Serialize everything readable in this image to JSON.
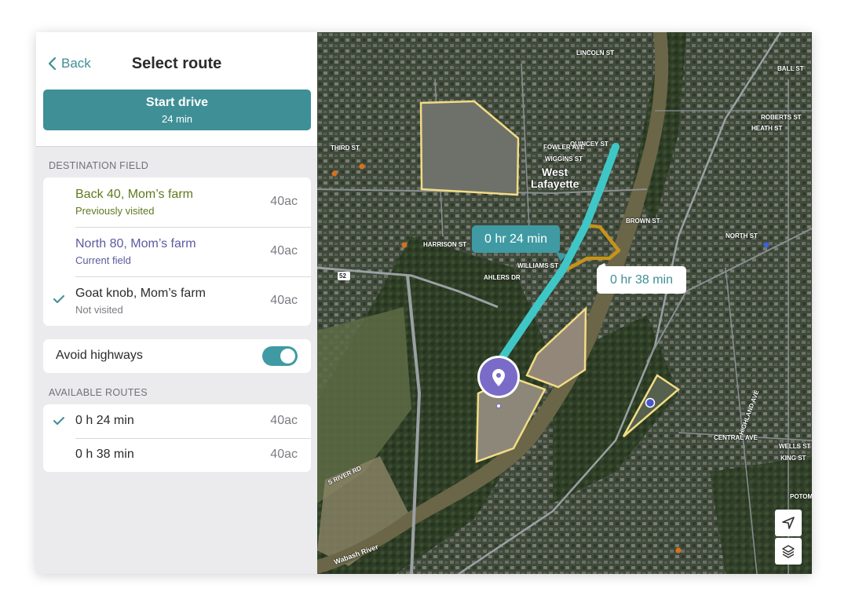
{
  "header": {
    "back_label": "Back",
    "title": "Select route"
  },
  "start_drive": {
    "label": "Start drive",
    "duration": "24 min"
  },
  "destination": {
    "section_label": "DESTINATION FIELD",
    "items": [
      {
        "name": "Back 40, Mom’s farm",
        "status": "Previously visited",
        "size": "40ac",
        "color": "#5e7a1f",
        "selected": false
      },
      {
        "name": "North 80, Mom’s farm",
        "status": "Current field",
        "size": "40ac",
        "color": "#5b5aa0",
        "selected": false
      },
      {
        "name": "Goat knob, Mom’s farm",
        "status": "Not visited",
        "size": "40ac",
        "color": "#2b2b2e",
        "selected": true
      }
    ]
  },
  "avoid_highways": {
    "label": "Avoid highways",
    "enabled": true
  },
  "routes": {
    "section_label": "AVAILABLE ROUTES",
    "items": [
      {
        "name": "0 h 24 min",
        "size": "40ac",
        "selected": true
      },
      {
        "name": "0 h 38 min",
        "size": "40ac",
        "selected": false
      }
    ]
  },
  "map": {
    "callout_primary": "0 hr 24 min",
    "callout_secondary": "0 hr 38 min",
    "city_label_1": "West",
    "city_label_2": "Lafayette",
    "street_labels": [
      "LINCOLN ST",
      "QUINCEY ST",
      "FOWLER AVE",
      "WIGGINS ST",
      "BROWN ST",
      "HARRISON ST",
      "WILLIAMS ST",
      "AHLERS DR",
      "THIRD ST",
      "NORTH ST",
      "HEATH ST",
      "ROBERTS ST",
      "BALL ST",
      "CENTRAL AVE",
      "WELLS ST",
      "KING ST",
      "S RIVER RD",
      "HIGHLAND AVE",
      "POTOMA",
      "Wabash River",
      "52"
    ],
    "colors": {
      "route": "#3fc7c7",
      "alt_route": "#c7931b",
      "field_outline": "#f3dc84",
      "pin": "#7a6bc8"
    }
  }
}
